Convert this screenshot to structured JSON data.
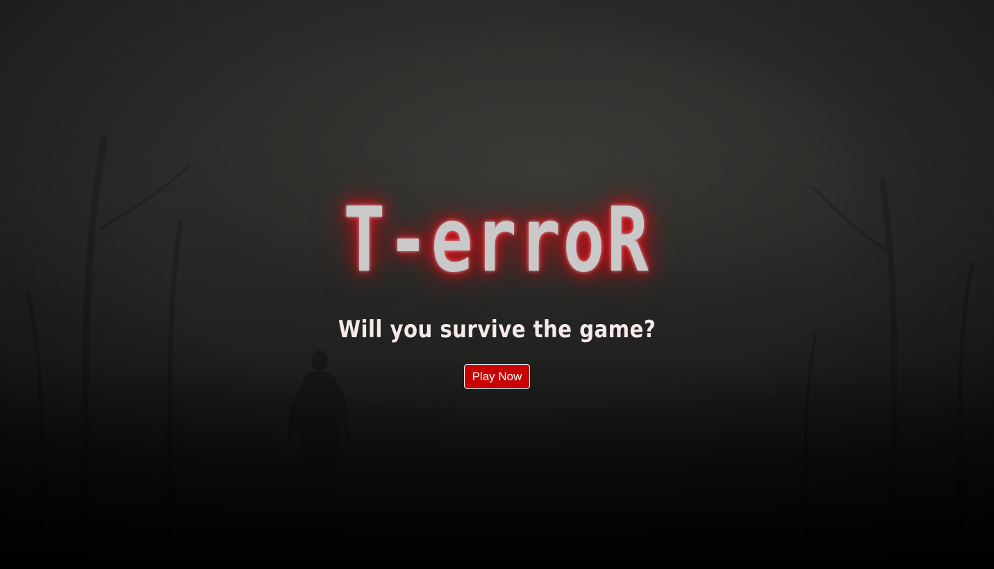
{
  "hero": {
    "title": "T-erroR",
    "subtitle": "Will you survive the game?",
    "play_button_label": "Play Now"
  },
  "colors": {
    "title_glow": "#e0141e",
    "button_background": "#c80306",
    "button_border": "#ffffff",
    "subtitle_text": "#f6e9ea"
  }
}
